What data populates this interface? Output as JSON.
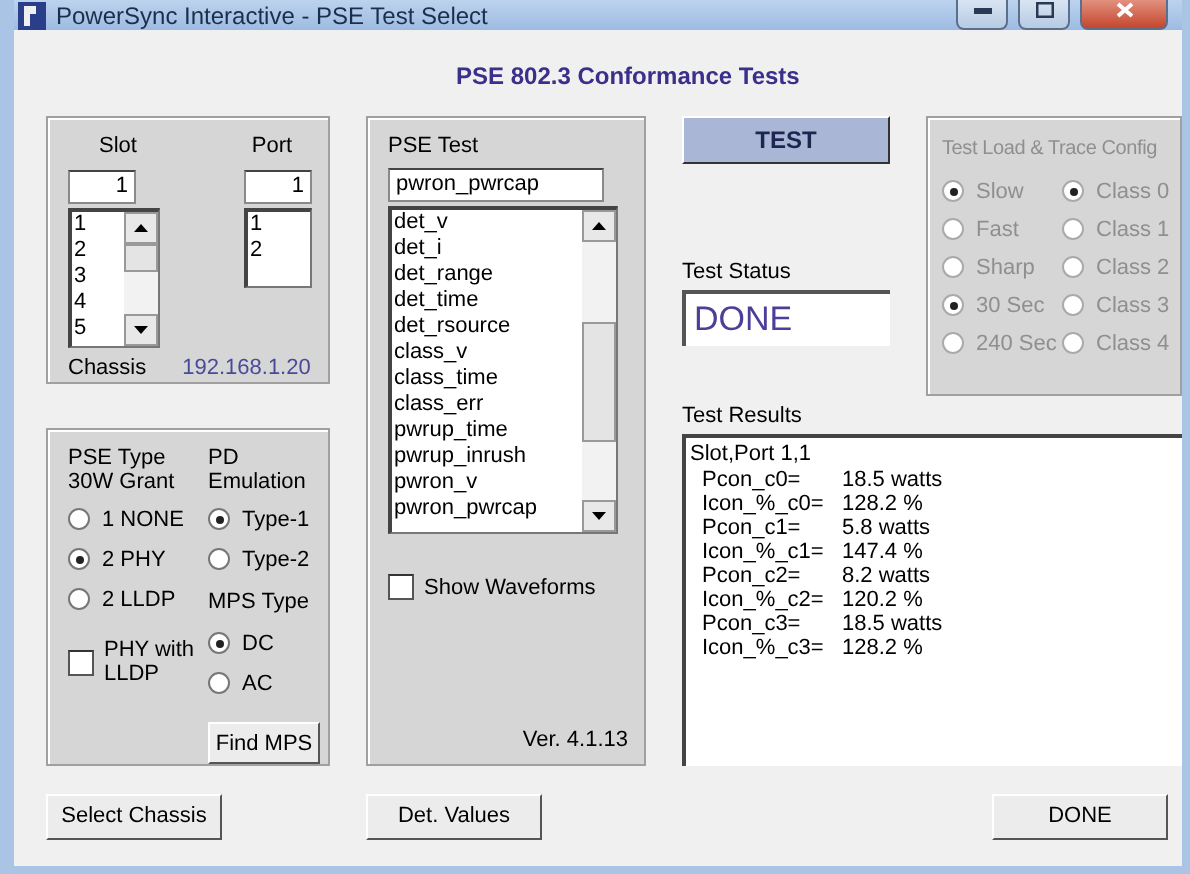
{
  "window": {
    "title": "PowerSync Interactive - PSE Test Select"
  },
  "heading": "PSE 802.3 Conformance Tests",
  "slot": {
    "label": "Slot",
    "value": "1",
    "items": [
      "1",
      "2",
      "3",
      "4",
      "5"
    ]
  },
  "port": {
    "label": "Port",
    "value": "1",
    "items": [
      "1",
      "2"
    ]
  },
  "chassis": {
    "label": "Chassis",
    "address": "192.168.1.20"
  },
  "pse_type": {
    "title": "PSE Type 30W Grant",
    "options": [
      {
        "label": "1 NONE",
        "selected": false
      },
      {
        "label": "2 PHY",
        "selected": true
      },
      {
        "label": "2 LLDP",
        "selected": false
      }
    ]
  },
  "pd_emulation": {
    "title": "PD Emulation",
    "options": [
      {
        "label": "Type-1",
        "selected": true
      },
      {
        "label": "Type-2",
        "selected": false
      }
    ]
  },
  "mps_type": {
    "title": "MPS Type",
    "options": [
      {
        "label": "DC",
        "selected": true
      },
      {
        "label": "AC",
        "selected": false
      }
    ]
  },
  "phy_with_lldp": {
    "label": "PHY with LLDP",
    "checked": false
  },
  "find_mps_button": "Find MPS",
  "pse_test": {
    "label": "PSE Test",
    "value": "pwron_pwrcap",
    "items": [
      "det_v",
      "det_i",
      "det_range",
      "det_time",
      "det_rsource",
      "class_v",
      "class_time",
      "class_err",
      "pwrup_time",
      "pwrup_inrush",
      "pwron_v",
      "pwron_pwrcap"
    ]
  },
  "show_waveforms": {
    "label": "Show Waveforms",
    "checked": false
  },
  "version": "Ver. 4.1.13",
  "test_button": "TEST",
  "test_status": {
    "label": "Test Status",
    "value": "DONE"
  },
  "config": {
    "title": "Test Load & Trace Config",
    "disabled": true,
    "modes": [
      {
        "label": "Slow",
        "selected": true
      },
      {
        "label": "Fast",
        "selected": false
      },
      {
        "label": "Sharp",
        "selected": false
      },
      {
        "label": "30 Sec",
        "selected": true
      },
      {
        "label": "240 Sec",
        "selected": false
      }
    ],
    "classes": [
      {
        "label": "Class 0",
        "selected": true
      },
      {
        "label": "Class 1",
        "selected": false
      },
      {
        "label": "Class 2",
        "selected": false
      },
      {
        "label": "Class 3",
        "selected": false
      },
      {
        "label": "Class 4",
        "selected": false
      }
    ]
  },
  "test_results": {
    "label": "Test Results",
    "header": "Slot,Port 1,1",
    "rows": [
      {
        "name": "Pcon_c0=",
        "value": "18.5 watts"
      },
      {
        "name": "Icon_%_c0=",
        "value": "128.2 %"
      },
      {
        "name": "Pcon_c1=",
        "value": "5.8 watts"
      },
      {
        "name": "Icon_%_c1=",
        "value": "147.4 %"
      },
      {
        "name": "Pcon_c2=",
        "value": "8.2 watts"
      },
      {
        "name": "Icon_%_c2=",
        "value": "120.2 %"
      },
      {
        "name": "Pcon_c3=",
        "value": "18.5 watts"
      },
      {
        "name": "Icon_%_c3=",
        "value": "128.2 %"
      }
    ]
  },
  "bottom_buttons": [
    {
      "label": "Select Chassis"
    },
    {
      "label": "Det. Values"
    },
    {
      "label": "DONE"
    }
  ]
}
